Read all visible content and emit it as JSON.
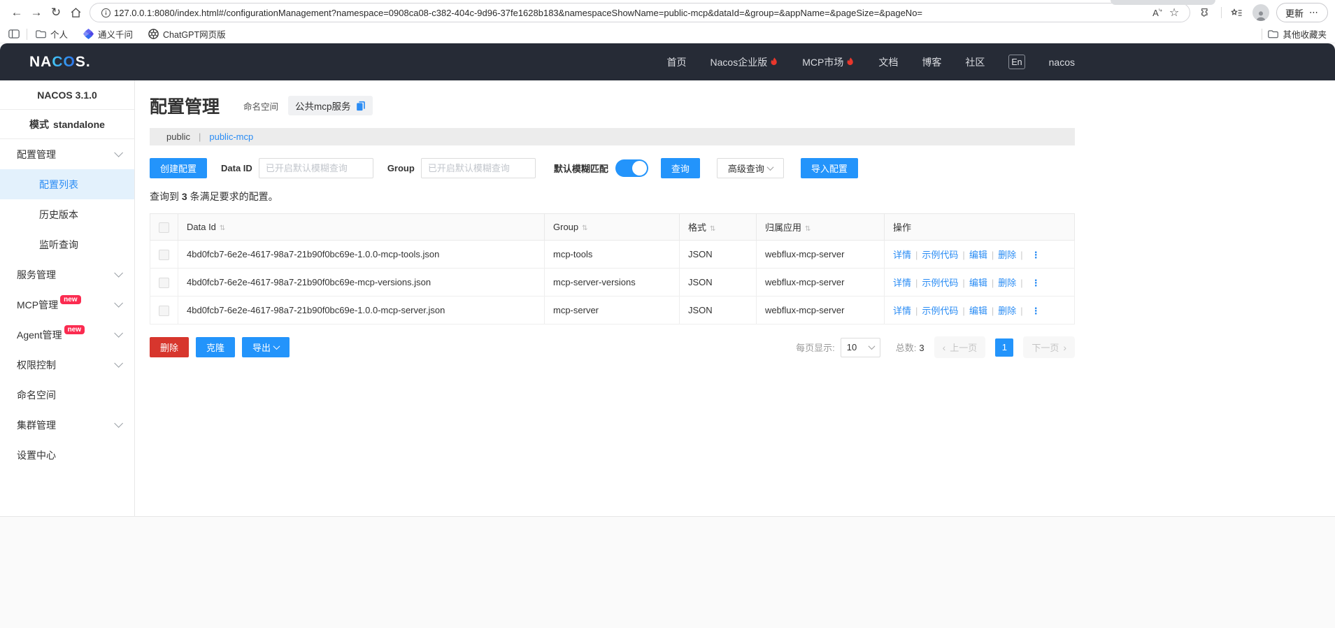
{
  "browser": {
    "url": "127.0.0.1:8080/index.html#/configurationManagement?namespace=0908ca08-c382-404c-9d96-37fe1628b183&namespaceShowName=public-mcp&dataId=&group=&appName=&pageSize=&pageNo=",
    "update_label": "更新",
    "bookmarks": {
      "personal": "个人",
      "qwen": "通义千问",
      "chatgpt": "ChatGPT网页版",
      "other": "其他收藏夹"
    }
  },
  "header": {
    "logo_na": "NA",
    "logo_co": "CO",
    "logo_s": "S.",
    "nav": [
      {
        "label": "首页"
      },
      {
        "label": "Nacos企业版"
      },
      {
        "label": "MCP市场"
      },
      {
        "label": "文档"
      },
      {
        "label": "博客"
      },
      {
        "label": "社区"
      }
    ],
    "lang": "En",
    "username": "nacos"
  },
  "sidebar": {
    "version": "NACOS 3.1.0",
    "mode_label": "模式",
    "mode_value": "standalone",
    "badge_new": "new",
    "items": [
      {
        "label": "配置管理"
      },
      {
        "label": "配置列表"
      },
      {
        "label": "历史版本"
      },
      {
        "label": "监听查询"
      },
      {
        "label": "服务管理"
      },
      {
        "label": "MCP管理"
      },
      {
        "label": "Agent管理"
      },
      {
        "label": "权限控制"
      },
      {
        "label": "命名空间"
      },
      {
        "label": "集群管理"
      },
      {
        "label": "设置中心"
      }
    ]
  },
  "main": {
    "title": "配置管理",
    "namespace_label": "命名空间",
    "namespace_chip": "公共mcp服务",
    "namespace_tabs": [
      {
        "label": "public"
      },
      {
        "label": "public-mcp"
      }
    ],
    "toolbar": {
      "create": "创建配置",
      "data_id_label": "Data ID",
      "data_id_placeholder": "已开启默认模糊查询",
      "group_label": "Group",
      "group_placeholder": "已开启默认模糊查询",
      "fuzzy_label": "默认模糊匹配",
      "search": "查询",
      "advanced": "高级查询",
      "import": "导入配置"
    },
    "result": {
      "prefix": "查询到",
      "count": "3",
      "suffix": "条满足要求的配置。"
    },
    "table": {
      "headers": [
        "Data Id",
        "Group",
        "格式",
        "归属应用",
        "操作"
      ],
      "actions": [
        "详情",
        "示例代码",
        "编辑",
        "删除"
      ],
      "rows": [
        {
          "data_id": "4bd0fcb7-6e2e-4617-98a7-21b90f0bc69e-1.0.0-mcp-tools.json",
          "group": "mcp-tools",
          "format": "JSON",
          "app": "webflux-mcp-server"
        },
        {
          "data_id": "4bd0fcb7-6e2e-4617-98a7-21b90f0bc69e-mcp-versions.json",
          "group": "mcp-server-versions",
          "format": "JSON",
          "app": "webflux-mcp-server"
        },
        {
          "data_id": "4bd0fcb7-6e2e-4617-98a7-21b90f0bc69e-1.0.0-mcp-server.json",
          "group": "mcp-server",
          "format": "JSON",
          "app": "webflux-mcp-server"
        }
      ]
    },
    "footer": {
      "delete": "删除",
      "clone": "克隆",
      "export": "导出"
    },
    "pagination": {
      "page_size_label": "每页显示:",
      "page_size": "10",
      "total_label": "总数:",
      "total": "3",
      "prev": "上一页",
      "page": "1",
      "next": "下一页"
    }
  },
  "colors": {
    "accent": "#2394fb",
    "danger": "#d7362d",
    "badge": "#fb2b50",
    "header_bg": "#262b36",
    "link": "#2a8cf4",
    "sidebar_active_bg": "#e3f1fc"
  }
}
